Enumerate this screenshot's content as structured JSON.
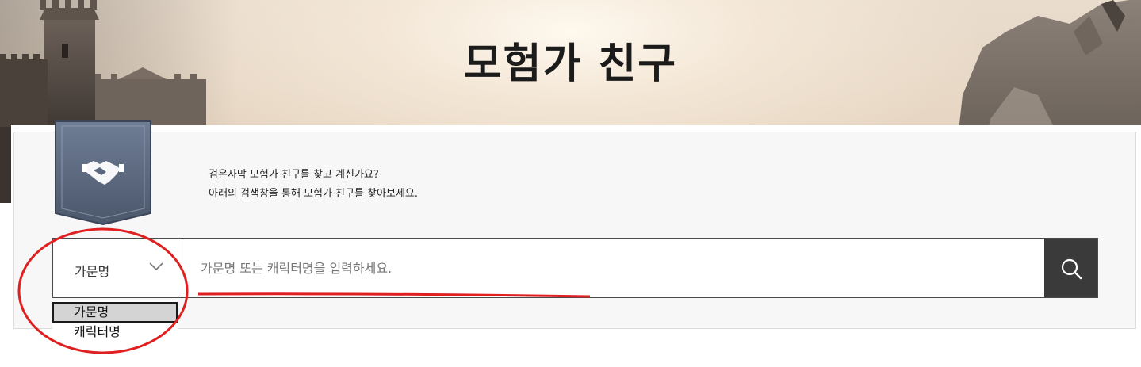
{
  "hero": {
    "title": "모험가 친구"
  },
  "intro": {
    "line1": "검은사막 모험가 친구를 찾고 계신가요?",
    "line2": "아래의 검색창을 통해 모험가 친구를 찾아보세요."
  },
  "ribbon": {
    "icon": "handshake-icon"
  },
  "search": {
    "selected_type": "가문명",
    "placeholder": "가문명 또는 캐릭터명을 입력하세요.",
    "value": "",
    "button_icon": "search-icon",
    "options": [
      "가문명",
      "캐릭터명"
    ]
  },
  "colors": {
    "search_button": "#3a3a3a",
    "ribbon": "#5c6a82",
    "annotation": "#e02020"
  }
}
